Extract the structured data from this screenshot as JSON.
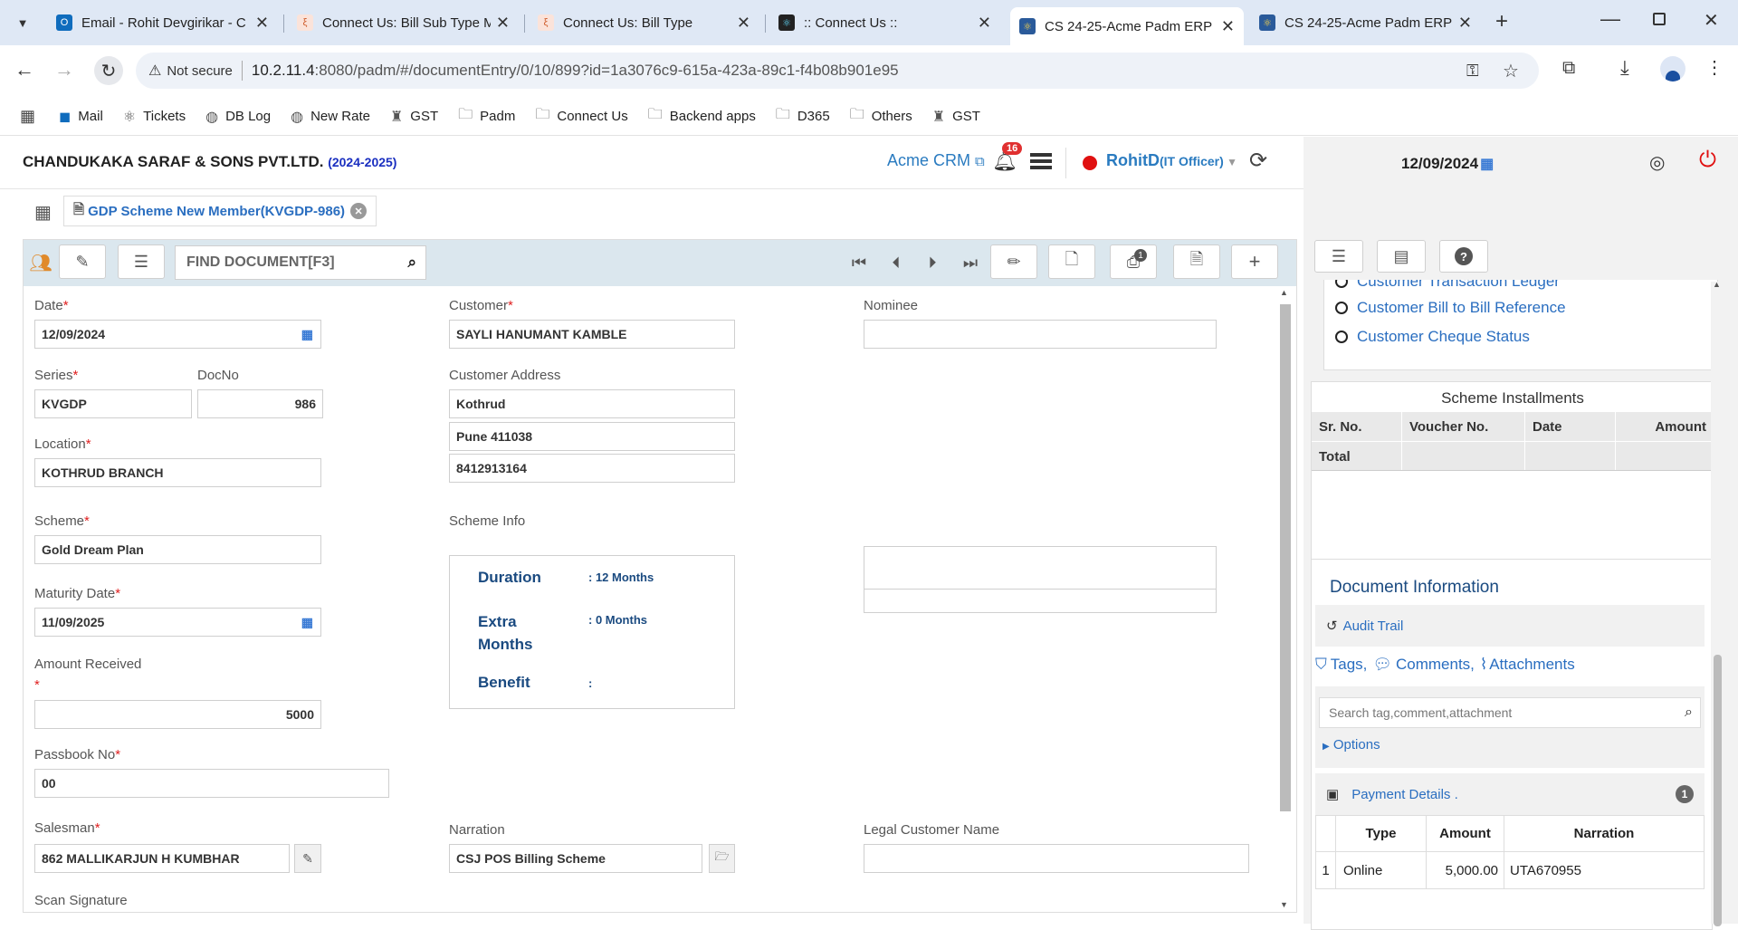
{
  "browser": {
    "tabs": [
      {
        "label": "Email - Rohit Devgirikar - C",
        "icon": "outlook-icon",
        "color": "#0f6cbd"
      },
      {
        "label": "Connect Us: Bill Sub Type M",
        "icon": "connectus-icon",
        "color": "#e8b0a0"
      },
      {
        "label": "Connect Us: Bill Type",
        "icon": "connectus-icon",
        "color": "#e8b0a0"
      },
      {
        "label": ":: Connect Us ::",
        "icon": "react-icon",
        "color": "#222"
      },
      {
        "label": "CS 24-25-Acme Padm ERP",
        "icon": "react-icon",
        "color": "#2a5a9a"
      },
      {
        "label": "CS 24-25-Acme Padm ERP",
        "icon": "react-icon",
        "color": "#2a5a9a"
      }
    ],
    "security": "Not secure",
    "url_host": "10.2.11.4",
    "url_rest": ":8080/padm/#/documentEntry/0/10/899?id=1a3076c9-615a-423a-89c1-f4b08b901e95",
    "bookmarks": [
      {
        "label": "Mail",
        "icon": "outlook-icon"
      },
      {
        "label": "Tickets",
        "icon": "react-icon"
      },
      {
        "label": "DB Log",
        "icon": "globe-icon"
      },
      {
        "label": "New Rate",
        "icon": "globe-icon"
      },
      {
        "label": "GST",
        "icon": "emblem-icon"
      },
      {
        "label": "Padm",
        "icon": "folder-icon"
      },
      {
        "label": "Connect Us",
        "icon": "folder-icon"
      },
      {
        "label": "Backend apps",
        "icon": "folder-icon"
      },
      {
        "label": "D365",
        "icon": "folder-icon"
      },
      {
        "label": "Others",
        "icon": "folder-icon"
      },
      {
        "label": "GST",
        "icon": "emblem-icon"
      }
    ]
  },
  "header": {
    "company": "CHANDUKAKA SARAF & SONS PVT.LTD.",
    "year": "(2024-2025)",
    "crm_link": "Acme CRM",
    "notifications": "16",
    "user": "RohitD",
    "role": "(IT Officer)",
    "date": "12/09/2024"
  },
  "doc_tab": {
    "label": "GDP Scheme New Member(KVGDP-986)"
  },
  "toolbar": {
    "find_placeholder": "FIND DOCUMENT[F3]",
    "print_badge": "1"
  },
  "form": {
    "date_label": "Date",
    "date_value": "12/09/2024",
    "series_label": "Series",
    "series_value": "KVGDP",
    "docno_label": "DocNo",
    "docno_value": "986",
    "location_label": "Location",
    "location_value": "KOTHRUD BRANCH",
    "scheme_label": "Scheme",
    "scheme_value": "Gold Dream Plan",
    "maturity_label": "Maturity Date",
    "maturity_value": "11/09/2025",
    "amount_label": "Amount Received",
    "amount_value": "5000",
    "passbook_label": "Passbook No",
    "passbook_value": "00",
    "salesman_label": "Salesman",
    "salesman_value": "862 MALLIKARJUN H KUMBHAR",
    "scan_label": "Scan Signature",
    "customer_label": "Customer",
    "customer_value": "SAYLI HANUMANT KAMBLE",
    "address_label": "Customer Address",
    "address_lines": [
      "Kothrud",
      "Pune 411038",
      "8412913164"
    ],
    "scheme_info_label": "Scheme Info",
    "duration_label": "Duration",
    "duration_value": ": 12 Months",
    "extra_label": "Extra Months",
    "extra_value": ": 0 Months",
    "benefit_label": "Benefit",
    "benefit_value": ":",
    "narration_label": "Narration",
    "narration_value": "CSJ POS Billing Scheme",
    "nominee_label": "Nominee",
    "nominee_value": "",
    "legal_label": "Legal Customer Name",
    "legal_value": ""
  },
  "side": {
    "links": [
      "Customer Transaction Ledger",
      "Customer Bill to Bill Reference",
      "Customer Cheque Status"
    ],
    "installments_title": "Scheme Installments",
    "inst_cols": [
      "Sr. No.",
      "Voucher No.",
      "Date",
      "Amount"
    ],
    "total_label": "Total",
    "docinfo_title": "Document Information",
    "audit": "Audit Trail",
    "tags": "Tags,",
    "comments": "Comments,",
    "attachments": "Attachments",
    "search_placeholder": "Search tag,comment,attachment",
    "options": "Options",
    "payment_title": "Payment Details .",
    "payment_count": "1",
    "pay_cols": [
      "Type",
      "Amount",
      "Narration"
    ],
    "pay_row": {
      "no": "1",
      "type": "Online",
      "amount": "5,000.00",
      "narration": "UTA670955"
    }
  }
}
